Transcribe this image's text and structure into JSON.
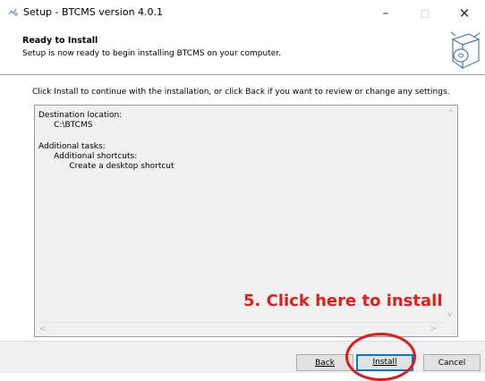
{
  "window": {
    "title": "Setup - BTCMS version 4.0.1",
    "minimize_glyph": "–",
    "maximize_glyph": "□",
    "close_glyph": "✕"
  },
  "header": {
    "title": "Ready to Install",
    "subtitle": "Setup is now ready to begin installing BTCMS on your computer."
  },
  "instruction": "Click Install to continue with the installation, or click Back if you want to review or change any settings.",
  "memo": {
    "lines": [
      "Destination location:",
      "      C:\\BTCMS",
      "",
      "Additional tasks:",
      "      Additional shortcuts:",
      "            Create a desktop shortcut"
    ],
    "scroll_up": "^",
    "scroll_down": "v",
    "scroll_left": "<",
    "scroll_right": ">"
  },
  "annotation": {
    "text": "5. Click here to install",
    "color": "#e0201b"
  },
  "buttons": {
    "back": "Back",
    "install": "Install",
    "cancel": "Cancel"
  },
  "icons": {
    "app": "setup-app-icon",
    "wizard": "software-box-icon"
  }
}
